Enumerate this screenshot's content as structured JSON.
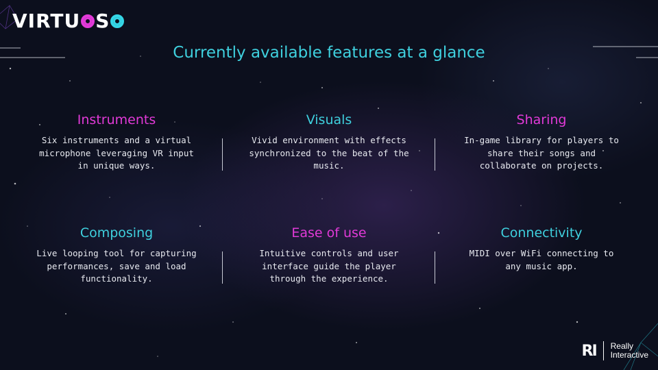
{
  "logo": {
    "parts": [
      "VIRTU",
      "O",
      "S",
      "O"
    ],
    "text": "VIRTUOSO"
  },
  "page_title": "Currently available features at a glance",
  "features": [
    {
      "title": "Instruments",
      "color": "#e23ad8",
      "description": "Six instruments and a virtual microphone leveraging VR input in unique ways."
    },
    {
      "title": "Visuals",
      "color": "#3fd0de",
      "description": "Vivid environment with effects synchronized to the beat of the music."
    },
    {
      "title": "Sharing",
      "color": "#e23ad8",
      "description": "In-game library for players to share their songs and collaborate on projects."
    },
    {
      "title": "Composing",
      "color": "#3fd0de",
      "description": "Live looping tool for capturing performances, save and load functionality."
    },
    {
      "title": "Ease of use",
      "color": "#e23ad8",
      "description": "Intuitive controls and user interface guide the player through the experience."
    },
    {
      "title": "Connectivity",
      "color": "#3fd0de",
      "description": "MIDI over WiFi connecting to any music app."
    }
  ],
  "brand": {
    "mark": "RI",
    "line1": "Really",
    "line2": "Interactive"
  },
  "colors": {
    "background": "#0c0f1d",
    "accent_cyan": "#3fd0de",
    "accent_pink": "#e23ad8"
  }
}
